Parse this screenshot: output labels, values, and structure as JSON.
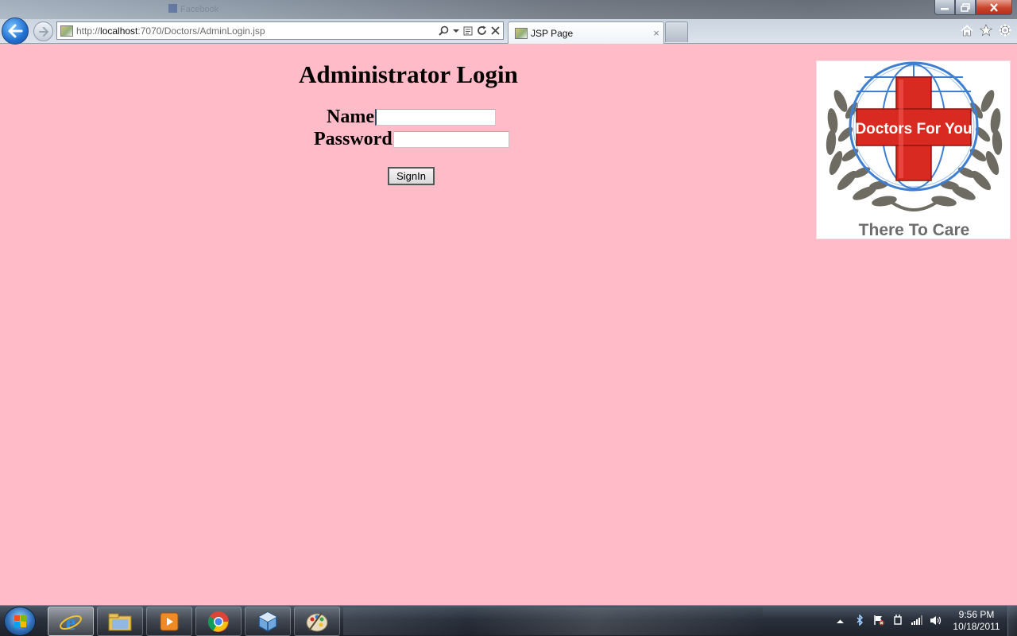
{
  "browser": {
    "url_prefix": "http://",
    "url_host": "localhost",
    "url_rest": ":7070/Doctors/AdminLogin.jsp",
    "tab_title": "JSP Page",
    "tab_close": "×",
    "ghost_tab_1": "",
    "ghost_tab_2": "Facebook"
  },
  "page": {
    "title": "Administrator Login",
    "name_label": "Name",
    "name_value": "",
    "password_label": "Password",
    "password_value": "",
    "signin_label": "SignIn"
  },
  "logo": {
    "brand_text": "Doctors For You",
    "tagline": "There To Care",
    "colors": {
      "cross": "#d92a22",
      "globe": "#3f7fd1",
      "laurel": "#6e6b62"
    }
  },
  "taskbar": {
    "time": "9:56 PM",
    "date": "10/18/2011",
    "apps": [
      "internet-explorer",
      "windows-explorer",
      "media-player",
      "chrome",
      "virtualbox",
      "paint"
    ]
  },
  "colors": {
    "page_background": "#ffbcc8"
  }
}
